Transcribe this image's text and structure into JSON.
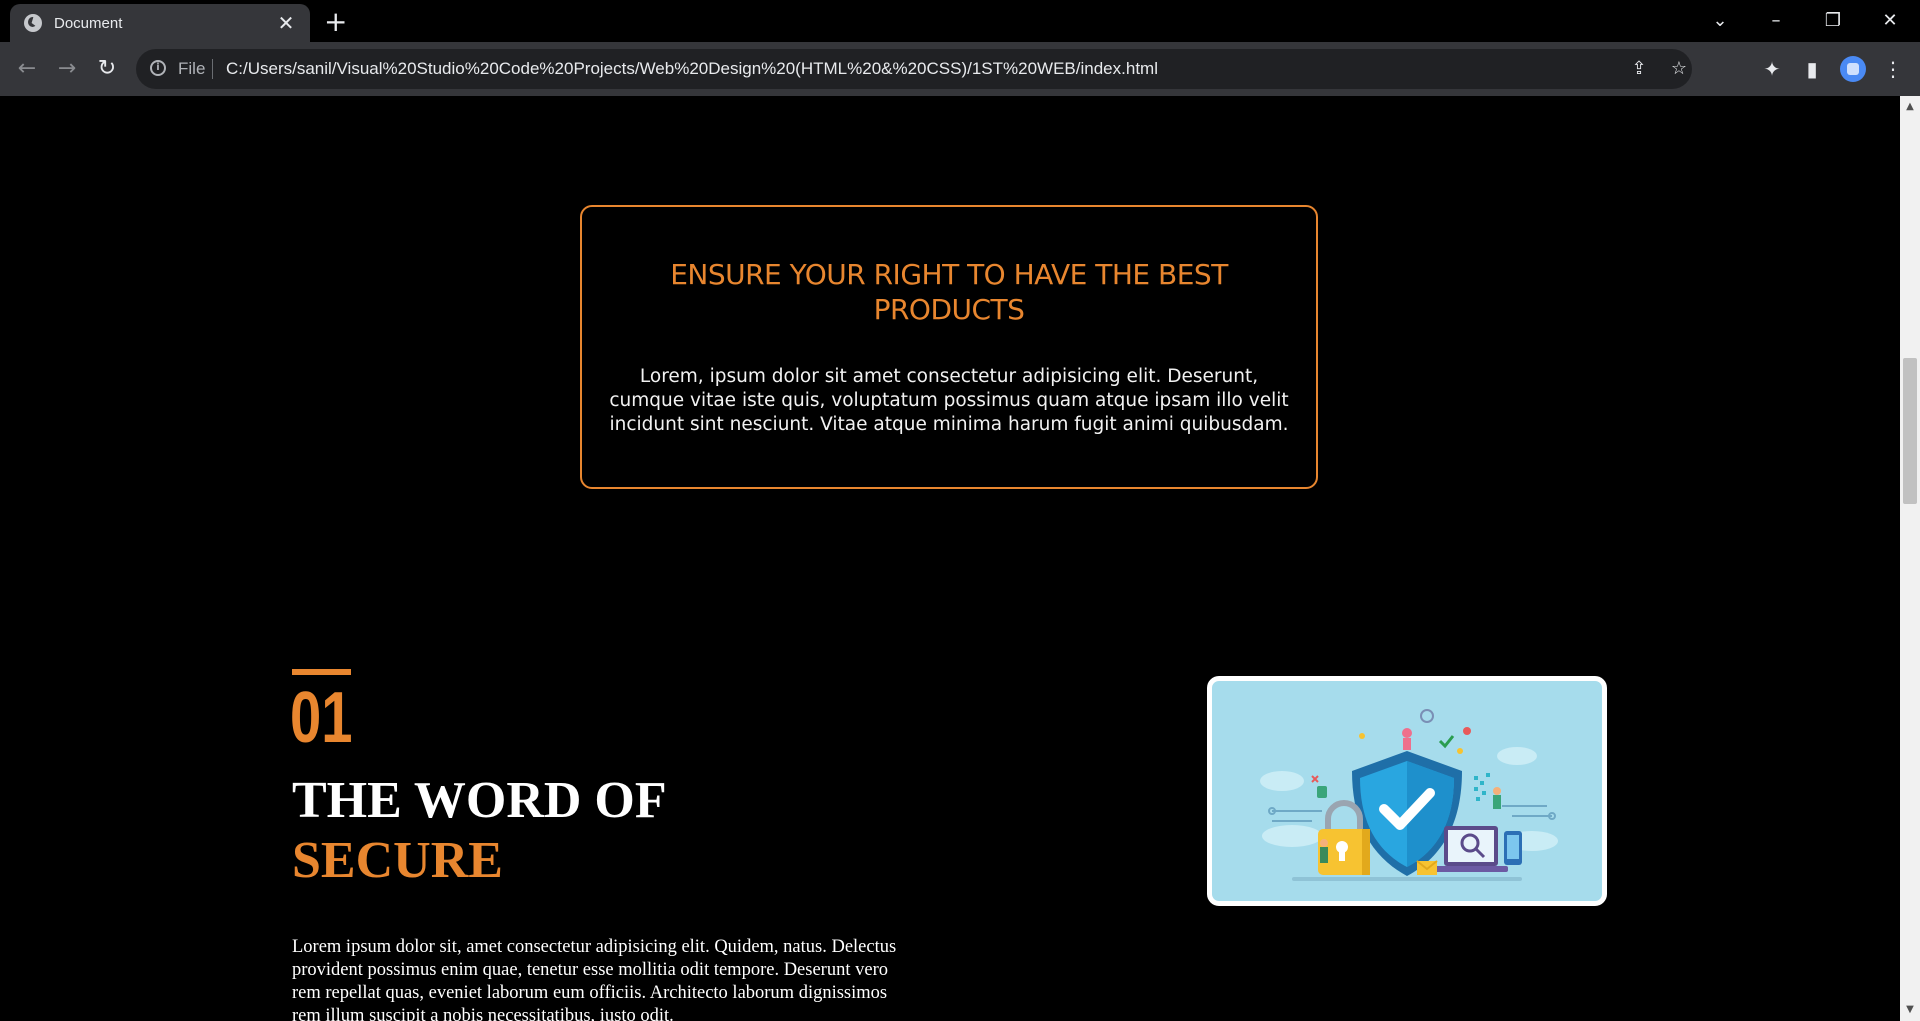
{
  "browser": {
    "tab_title": "Document",
    "address_scheme_label": "File",
    "address_url": "C:/Users/sanil/Visual%20Studio%20Code%20Projects/Web%20Design%20(HTML%20&%20CSS)/1ST%20WEB/index.html"
  },
  "promo": {
    "title": "ENSURE YOUR RIGHT TO HAVE THE BEST PRODUCTS",
    "text": "Lorem, ipsum dolor sit amet consectetur adipisicing elit. Deserunt, cumque vitae iste quis, voluptatum possimus quam atque ipsam illo velit incidunt sint nesciunt. Vitae atque minima harum fugit animi quibusdam."
  },
  "feature": {
    "number": "01",
    "heading_line1": "THE WORD OF",
    "heading_line2": "SECURE",
    "text": "Lorem ipsum dolor sit, amet consectetur adipisicing elit. Quidem, natus. Delectus provident possimus enim quae, tenetur esse mollitia odit tempore. Deserunt vero rem repellat quas, eveniet laborum eum officiis. Architecto laborum dignissimos rem illum suscipit a nobis necessitatibus, iusto odit."
  },
  "colors": {
    "accent": "#e8862f",
    "page_background": "#000000",
    "image_background": "#a6dcec"
  }
}
